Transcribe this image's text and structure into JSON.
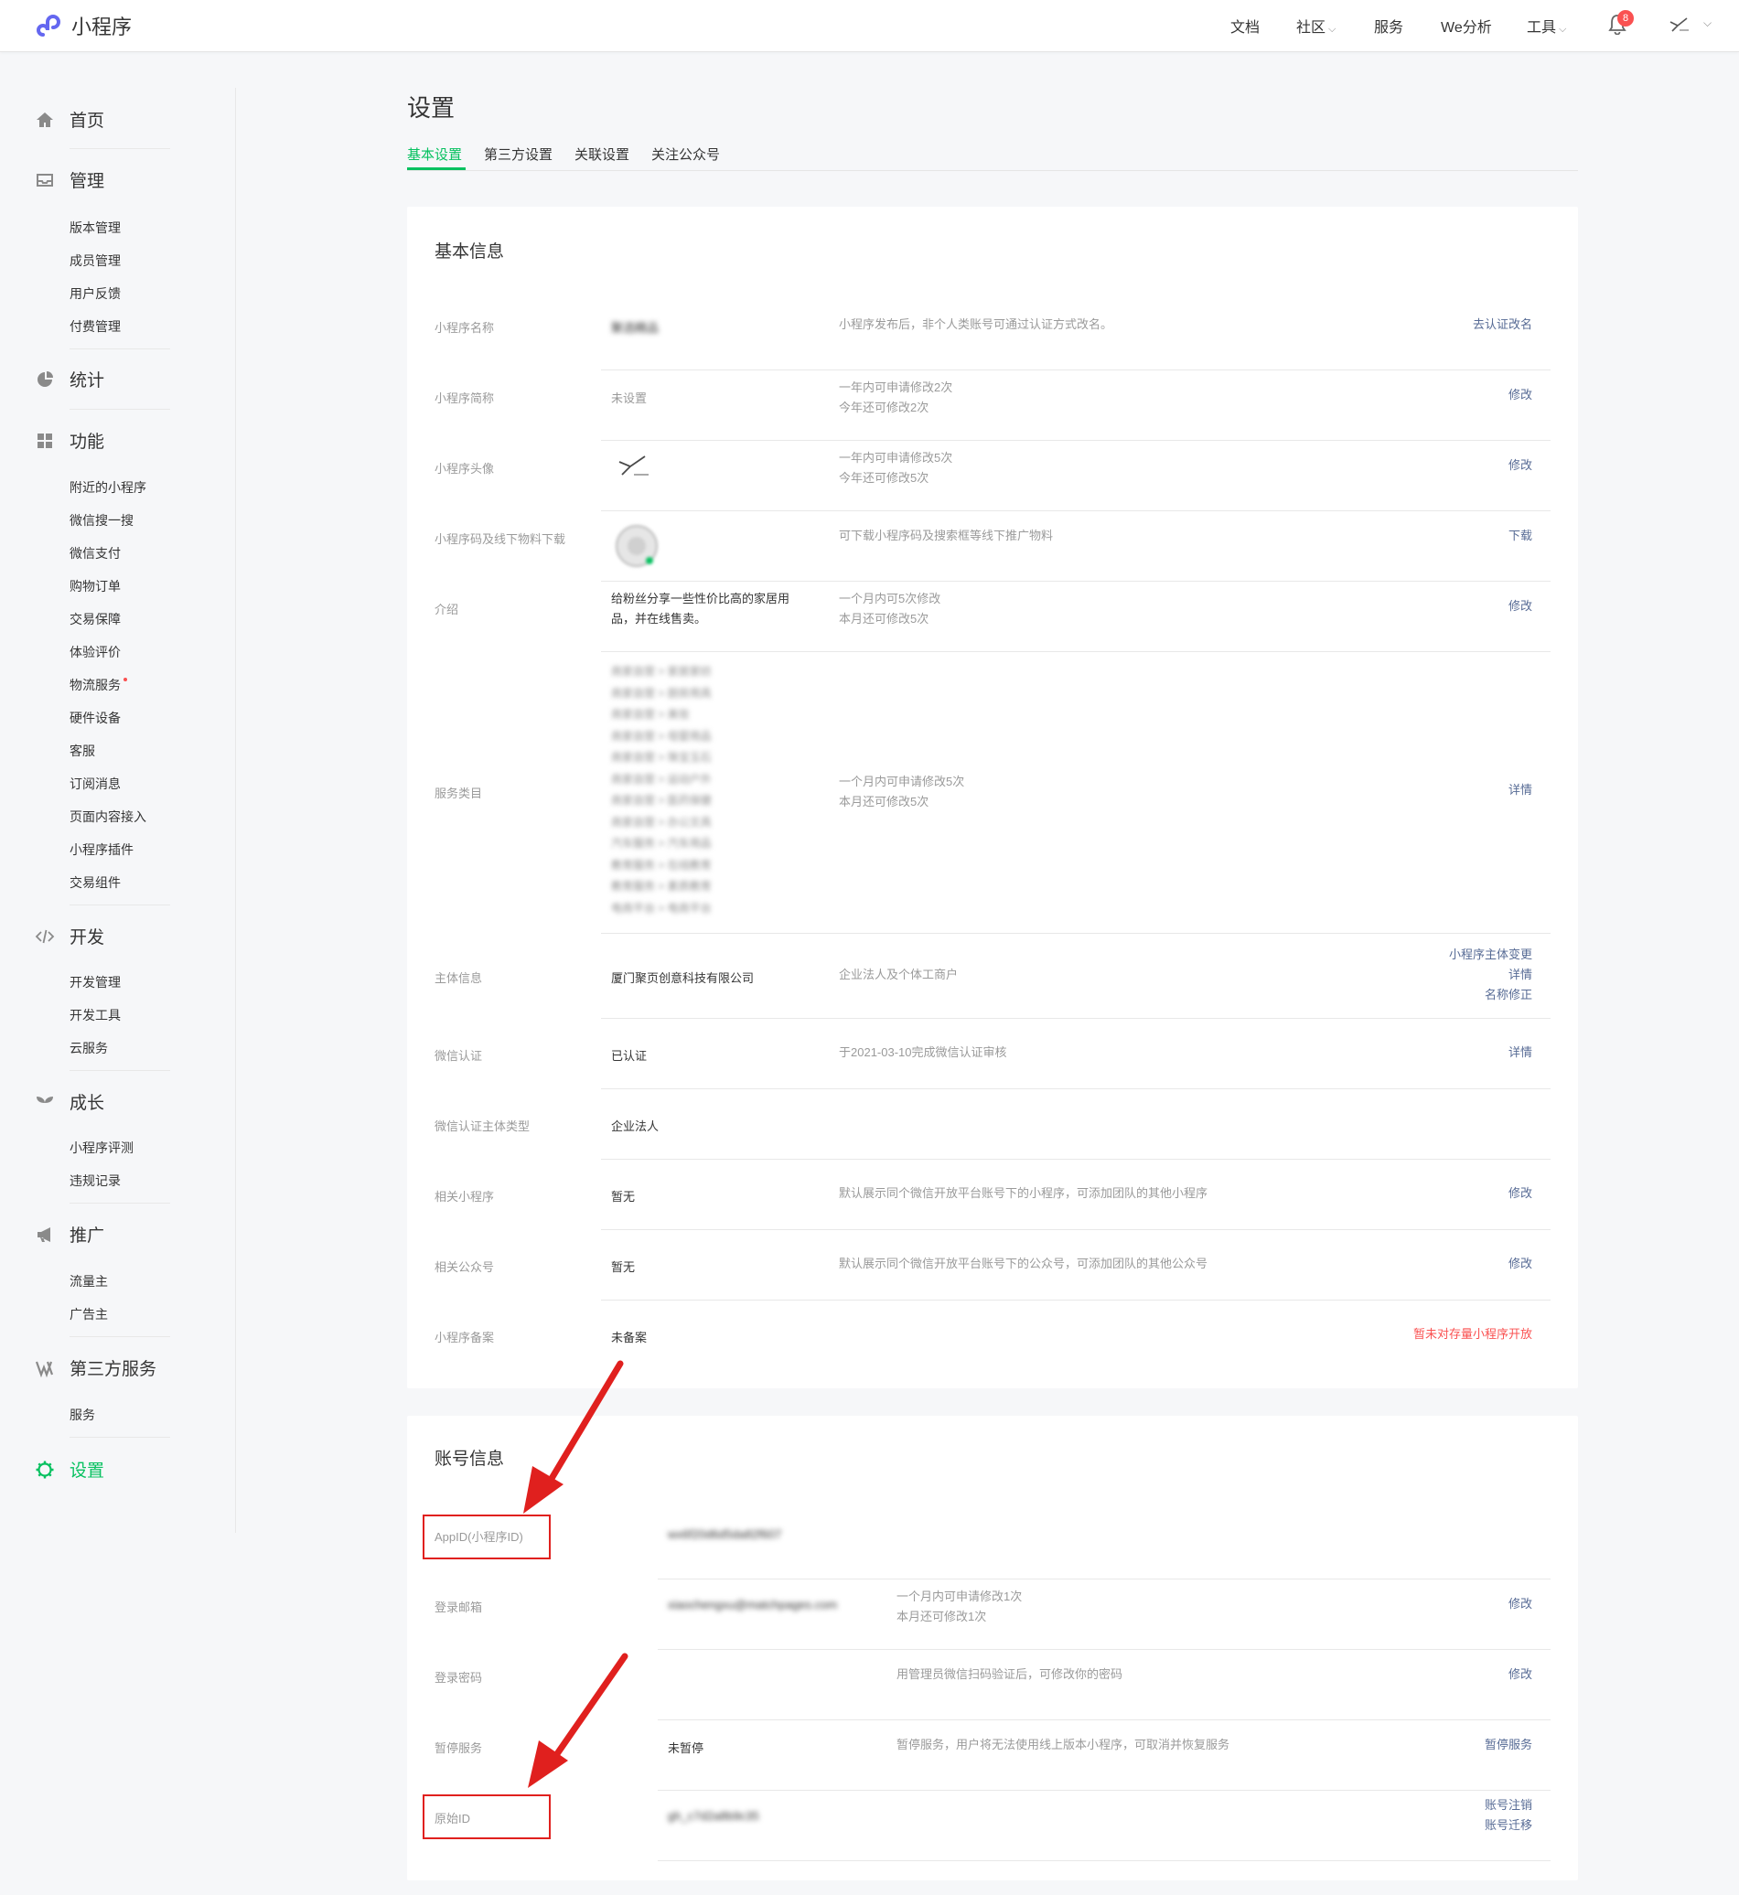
{
  "header": {
    "brand": "小程序",
    "nav": {
      "docs": "文档",
      "community": "社区",
      "service": "服务",
      "analysis": "We分析",
      "tools": "工具"
    },
    "notification_count": "8",
    "colors": {
      "accent": "#07c160",
      "link": "#576b95",
      "badge": "#fa5151"
    }
  },
  "sidebar": {
    "home": "首页",
    "manage": "管理",
    "manage_items": [
      "版本管理",
      "成员管理",
      "用户反馈",
      "付费管理"
    ],
    "stats": "统计",
    "features": "功能",
    "feature_items": [
      "附近的小程序",
      "微信搜一搜",
      "微信支付",
      "购物订单",
      "交易保障",
      "体验评价",
      "物流服务",
      "硬件设备",
      "客服",
      "订阅消息",
      "页面内容接入",
      "小程序插件",
      "交易组件"
    ],
    "dev": "开发",
    "dev_items": [
      "开发管理",
      "开发工具",
      "云服务"
    ],
    "growth": "成长",
    "growth_items": [
      "小程序评测",
      "违规记录"
    ],
    "promote": "推广",
    "promote_items": [
      "流量主",
      "广告主"
    ],
    "third_party": "第三方服务",
    "third_party_items": [
      "服务"
    ],
    "settings": "设置"
  },
  "page": {
    "title": "设置",
    "tabs": [
      "基本设置",
      "第三方设置",
      "关联设置",
      "关注公众号"
    ]
  },
  "basic_info": {
    "title": "基本信息",
    "rows": {
      "name": {
        "label": "小程序名称",
        "value": "聚选精品",
        "tip": "小程序发布后，非个人类账号可通过认证方式改名。",
        "action": "去认证改名"
      },
      "short_name": {
        "label": "小程序简称",
        "value": "未设置",
        "tip1": "一年内可申请修改2次",
        "tip2": "今年还可修改2次",
        "action": "修改"
      },
      "avatar": {
        "label": "小程序头像",
        "tip1": "一年内可申请修改5次",
        "tip2": "今年还可修改5次",
        "action": "修改"
      },
      "qrcode": {
        "label": "小程序码及线下物料下载",
        "tip": "可下载小程序码及搜索框等线下推广物料",
        "action": "下载"
      },
      "intro": {
        "label": "介绍",
        "value1": "给粉丝分享一些性价比高的家居用",
        "value2": "品，并在线售卖。",
        "tip1": "一个月内可5次修改",
        "tip2": "本月还可修改5次",
        "action": "修改"
      },
      "category": {
        "label": "服务类目",
        "items": [
          "商家自营 > 家居家纺",
          "商家自营 > 厨房用具",
          "商家自营 > 美妆",
          "商家自营 > 母婴用品",
          "商家自营 > 珠宝玉石",
          "商家自营 > 运动户外",
          "商家自营 > 医药保健",
          "商家自营 > 办公文具",
          "汽车服务 > 汽车用品",
          "教育服务 > 在线教育",
          "教育服务 > 素质教育",
          "电商平台 > 电商平台"
        ],
        "tip1": "一个月内可申请修改5次",
        "tip2": "本月还可修改5次",
        "action": "详情"
      },
      "entity": {
        "label": "主体信息",
        "value": "厦门聚页创意科技有限公司",
        "tip": "企业法人及个体工商户",
        "action1": "小程序主体变更",
        "action2": "详情",
        "action3": "名称修正"
      },
      "cert": {
        "label": "微信认证",
        "value": "已认证",
        "tip": "于2021-03-10完成微信认证审核",
        "action": "详情"
      },
      "cert_type": {
        "label": "微信认证主体类型",
        "value": "企业法人"
      },
      "related_mp": {
        "label": "相关小程序",
        "value": "暂无",
        "tip": "默认展示同个微信开放平台账号下的小程序，可添加团队的其他小程序",
        "action": "修改"
      },
      "related_oa": {
        "label": "相关公众号",
        "value": "暂无",
        "tip": "默认展示同个微信开放平台账号下的公众号，可添加团队的其他公众号",
        "action": "修改"
      },
      "filing": {
        "label": "小程序备案",
        "value": "未备案",
        "action": "暂未对存量小程序开放"
      }
    }
  },
  "account_info": {
    "title": "账号信息",
    "rows": {
      "appid": {
        "label": "AppID(小程序ID)",
        "value": "wx6f20d6d5da82f607"
      },
      "email": {
        "label": "登录邮箱",
        "value": "xiaochengxu@matchpages.com",
        "tip1": "一个月内可申请修改1次",
        "tip2": "本月还可修改1次",
        "action": "修改"
      },
      "password": {
        "label": "登录密码",
        "tip": "用管理员微信扫码验证后，可修改你的密码",
        "action": "修改"
      },
      "suspend": {
        "label": "暂停服务",
        "value": "未暂停",
        "tip": "暂停服务，用户将无法使用线上版本小程序，可取消并恢复服务",
        "action": "暂停服务"
      },
      "original_id": {
        "label": "原始ID",
        "value": "gh_c7d2a8b9c35",
        "action1": "账号注销",
        "action2": "账号迁移"
      }
    }
  }
}
